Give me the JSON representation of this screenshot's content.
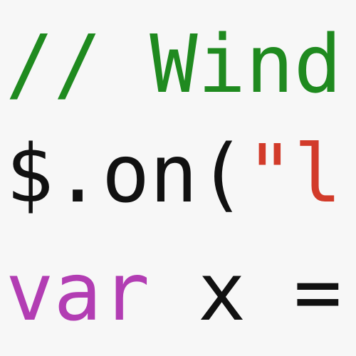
{
  "editor": {
    "colors": {
      "background": "#f7f7f7",
      "comment": "#1f8a1f",
      "plain": "#111111",
      "string": "#d23b2a",
      "keyword": "#b23db3"
    },
    "lines": [
      {
        "tokens": [
          {
            "type": "comment",
            "text": "// Wind"
          }
        ]
      },
      {
        "tokens": [
          {
            "type": "plain",
            "text": "$.on("
          },
          {
            "type": "string",
            "text": "\"l"
          }
        ]
      },
      {
        "tokens": [
          {
            "type": "keyword",
            "text": "var"
          },
          {
            "type": "plain",
            "text": " x ="
          }
        ]
      }
    ]
  }
}
